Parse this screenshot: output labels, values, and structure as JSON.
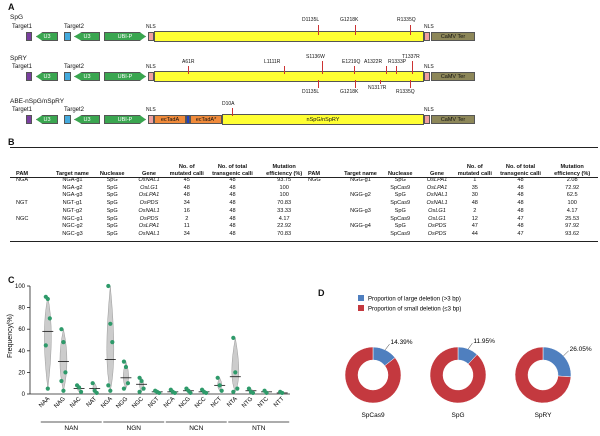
{
  "panels": {
    "a": "A",
    "b": "B",
    "c": "C",
    "d": "D"
  },
  "constructs": [
    {
      "name": "SpG",
      "target1": "Target1",
      "target2": "Target2",
      "u3a": "U3",
      "u3b": "U3",
      "ubi": "UBI-P",
      "nls_left": "NLS",
      "nls_right": "NLS",
      "ter": "CaMV Ter",
      "mut_top": [
        "D1135L",
        "G1218K",
        "R1335Q"
      ],
      "mut_bottom": []
    },
    {
      "name": "SpRY",
      "target1": "Target1",
      "target2": "Target2",
      "u3a": "U3",
      "u3b": "U3",
      "ubi": "UBI-P",
      "nls_left": "NLS",
      "nls_right": "NLS",
      "ter": "CaMV Ter",
      "mut_top": [
        "A61R",
        "L1111R",
        "S1136W",
        "E1219Q",
        "A1322R",
        "R1333P",
        "T1337R"
      ],
      "mut_bottom": [
        "D1135L",
        "G1218K",
        "N1317R",
        "R1335Q"
      ]
    },
    {
      "name": "ABE-nSpG/nSpRY",
      "target1": "Target1",
      "target2": "Target2",
      "u3a": "U3",
      "u3b": "U3",
      "ubi": "UBI-P",
      "nls_left": "NLS",
      "nls_right": "NLS",
      "ter": "CaMV Ter",
      "tada": "ecTadA",
      "tada2": "ecTadA*",
      "d10a": "D10A",
      "body": "nSpG/nSpRY"
    }
  ],
  "table": {
    "headers": [
      "PAM",
      "Target name",
      "Nuclease",
      "Gene",
      "No. of mutated calli",
      "No. of total transgenic calli",
      "Mutation efficiency (%)"
    ],
    "left": [
      [
        "NGA",
        "NGA-g1",
        "SpG",
        "OsNAL1",
        "45",
        "48",
        "93.75"
      ],
      [
        "",
        "NGA-g2",
        "SpG",
        "OsLG1",
        "48",
        "48",
        "100"
      ],
      [
        "",
        "NGA-g3",
        "SpG",
        "OsLPA1",
        "48",
        "48",
        "100"
      ],
      [
        "NGT",
        "NGT-g1",
        "SpG",
        "OsPDS",
        "34",
        "48",
        "70.83"
      ],
      [
        "",
        "NGT-g2",
        "SpG",
        "OsNAL1",
        "16",
        "48",
        "33.33"
      ],
      [
        "NGC",
        "NGC-g1",
        "SpG",
        "OsPDS",
        "2",
        "48",
        "4.17"
      ],
      [
        "",
        "NGC-g2",
        "SpG",
        "OsLPA1",
        "11",
        "48",
        "22.92"
      ],
      [
        "",
        "NGC-g3",
        "SpG",
        "OsNAL1",
        "34",
        "48",
        "70.83"
      ]
    ],
    "right": [
      [
        "NGG",
        "NGG-g1",
        "SpG",
        "OsLPA1",
        "1",
        "48",
        "2.08"
      ],
      [
        "",
        "",
        "SpCas9",
        "OsLPA1",
        "35",
        "48",
        "72.92"
      ],
      [
        "",
        "NGG-g2",
        "SpG",
        "OsNAL1",
        "30",
        "48",
        "62.5"
      ],
      [
        "",
        "",
        "SpCas9",
        "OsNAL1",
        "48",
        "48",
        "100"
      ],
      [
        "",
        "NGG-g3",
        "SpG",
        "OsLG1",
        "2",
        "48",
        "4.17"
      ],
      [
        "",
        "",
        "SpCas9",
        "OsLG1",
        "12",
        "47",
        "25.53"
      ],
      [
        "",
        "NGG-g4",
        "SpG",
        "OsPDS",
        "47",
        "48",
        "97.92"
      ],
      [
        "",
        "",
        "SpCas9",
        "OsPDS",
        "44",
        "47",
        "93.62"
      ]
    ]
  },
  "chart_data": [
    {
      "type": "scatter",
      "ylabel": "Frequency(%)",
      "ylim": [
        0,
        100
      ],
      "yticks": [
        0,
        20,
        40,
        60,
        80,
        100
      ],
      "categories": [
        "NAA",
        "NAG",
        "NAC",
        "NAT",
        "NGA",
        "NGG",
        "NGC",
        "NGT",
        "NCA",
        "NCG",
        "NCC",
        "NCT",
        "NTA",
        "NTG",
        "NTC",
        "NTT"
      ],
      "groups": [
        {
          "label": "NAN",
          "members": [
            "NAA",
            "NAG",
            "NAC",
            "NAT"
          ]
        },
        {
          "label": "NGN",
          "members": [
            "NGA",
            "NGG",
            "NGC",
            "NGT"
          ]
        },
        {
          "label": "NCN",
          "members": [
            "NCA",
            "NCG",
            "NCC",
            "NCT"
          ]
        },
        {
          "label": "NTN",
          "members": [
            "NTA",
            "NTG",
            "NTC",
            "NTT"
          ]
        }
      ],
      "points": [
        [
          90,
          88,
          70,
          45,
          5
        ],
        [
          60,
          48,
          20,
          12,
          3
        ],
        [
          8,
          6,
          2
        ],
        [
          10,
          3,
          1
        ],
        [
          100,
          65,
          48,
          8,
          3
        ],
        [
          30,
          25,
          10,
          5
        ],
        [
          15,
          12,
          5,
          2
        ],
        [
          3,
          2,
          1
        ],
        [
          4,
          2,
          1
        ],
        [
          5,
          3,
          1
        ],
        [
          4,
          2,
          1
        ],
        [
          15,
          8,
          3
        ],
        [
          52,
          20,
          5,
          2
        ],
        [
          5,
          2,
          1
        ],
        [
          3,
          1
        ],
        [
          2,
          1
        ]
      ],
      "means": [
        58,
        30,
        5,
        5,
        32,
        15,
        9,
        2,
        2,
        3,
        2,
        8,
        16,
        3,
        2,
        1
      ],
      "point_color": "#2e9a6a"
    },
    {
      "type": "pie",
      "series": [
        {
          "name": "Proportion of large deletion (>3 bp)",
          "color": "#4f7fbf"
        },
        {
          "name": "Proportion of small deletion (≤3 bp)",
          "color": "#c4393f"
        }
      ],
      "charts": [
        {
          "label": "SpCas9",
          "large": 14.39,
          "pct_label": "14.39%"
        },
        {
          "label": "SpG",
          "large": 11.95,
          "pct_label": "11.95%"
        },
        {
          "label": "SpRY",
          "large": 26.05,
          "pct_label": "26.05%"
        }
      ]
    }
  ]
}
